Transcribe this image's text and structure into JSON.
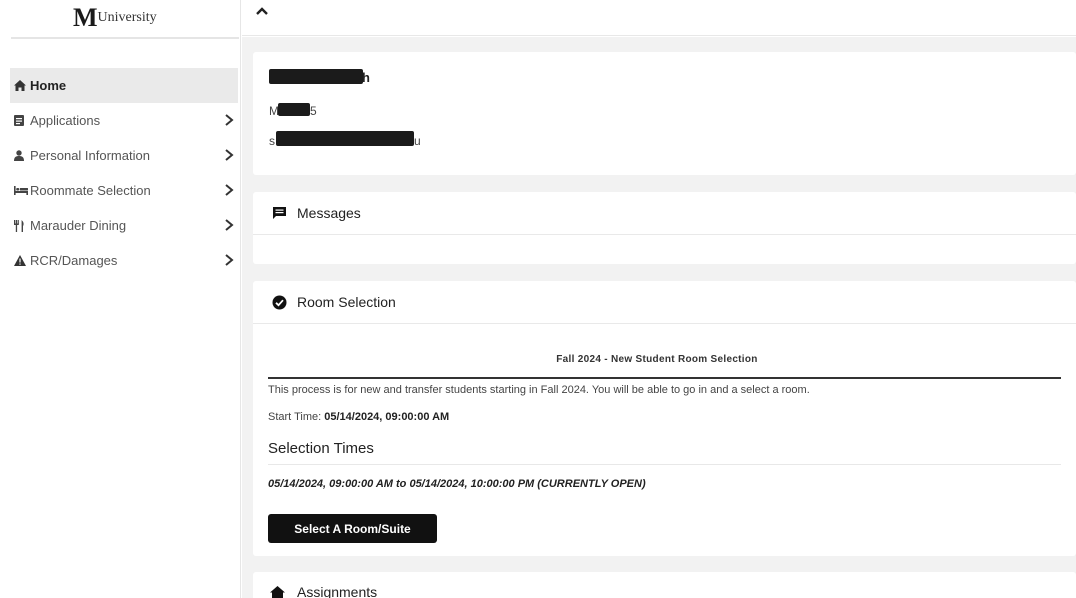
{
  "brand": {
    "mark": "M",
    "word": "University"
  },
  "sidebar": {
    "items": [
      {
        "label": "Home",
        "icon": "home-icon",
        "active": true,
        "has_chevron": false
      },
      {
        "label": "Applications",
        "icon": "document-icon",
        "active": false,
        "has_chevron": true
      },
      {
        "label": "Personal Information",
        "icon": "user-icon",
        "active": false,
        "has_chevron": true
      },
      {
        "label": "Roommate Selection",
        "icon": "bed-icon",
        "active": false,
        "has_chevron": true
      },
      {
        "label": "Marauder Dining",
        "icon": "utensils-icon",
        "active": false,
        "has_chevron": true
      },
      {
        "label": "RCR/Damages",
        "icon": "warning-icon",
        "active": false,
        "has_chevron": true
      }
    ]
  },
  "topbar": {
    "icon": "chevron-up-icon"
  },
  "profile": {
    "name_suffix": "h",
    "id_prefix": "M",
    "id_suffix": "5",
    "email_prefix": "s",
    "email_suffix": "u"
  },
  "messages": {
    "title": "Messages",
    "icon": "message-icon"
  },
  "room_selection": {
    "title": "Room Selection",
    "icon": "check-circle-icon",
    "process_title": "Fall 2024 - New Student Room Selection",
    "description": "This process is for new and transfer students starting in Fall 2024. You will be able to go in and a select a room.",
    "start_label": "Start Time:",
    "start_value": "05/14/2024, 09:00:00 AM",
    "selection_times_title": "Selection Times",
    "time_window": "05/14/2024, 09:00:00 AM to 05/14/2024, 10:00:00 PM (CURRENTLY OPEN)",
    "button_label": "Select A Room/Suite"
  },
  "assignments": {
    "title": "Assignments",
    "icon": "home-icon"
  },
  "colors": {
    "sidebar_active_bg": "#eaeaea",
    "page_bg": "#f2f2f2",
    "button_bg": "#111111"
  }
}
